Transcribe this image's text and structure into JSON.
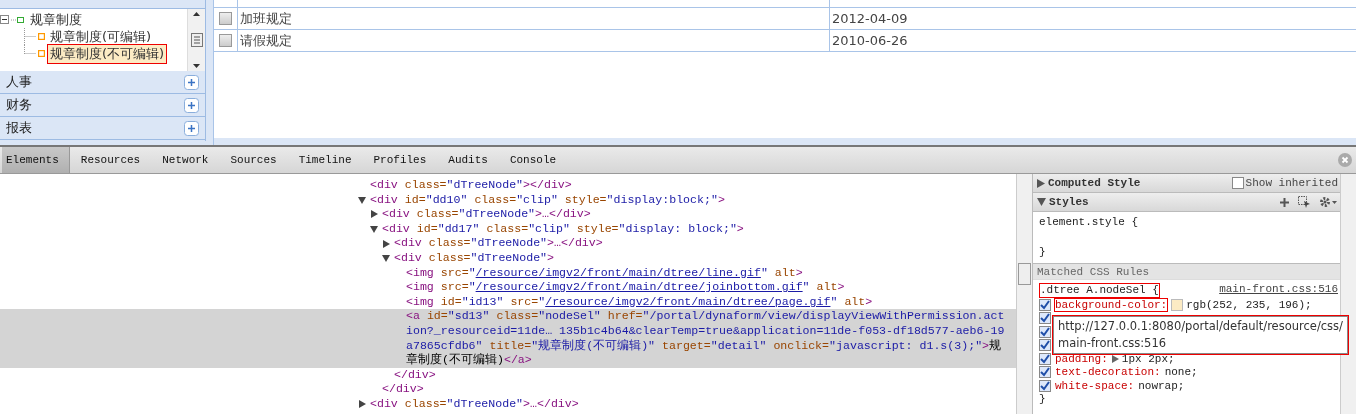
{
  "sidebar": {
    "tree": [
      {
        "label": "规章制度",
        "expanded": true,
        "children": [
          {
            "label": "规章制度(可编辑)",
            "selected": false,
            "annotated": false
          },
          {
            "label": "规章制度(不可编辑)",
            "selected": true,
            "annotated": true
          }
        ]
      }
    ],
    "sections": [
      {
        "label": "人事"
      },
      {
        "label": "财务"
      },
      {
        "label": "报表"
      }
    ]
  },
  "table": {
    "rows": [
      {
        "title": "加班规定",
        "date": "2012-04-09",
        "checked": false
      },
      {
        "title": "请假规定",
        "date": "2010-06-26",
        "checked": false
      }
    ]
  },
  "devtools": {
    "tabs": [
      {
        "label": "Elements",
        "selected": true
      },
      {
        "label": "Resources",
        "selected": false
      },
      {
        "label": "Network",
        "selected": false
      },
      {
        "label": "Sources",
        "selected": false
      },
      {
        "label": "Timeline",
        "selected": false
      },
      {
        "label": "Profiles",
        "selected": false
      },
      {
        "label": "Audits",
        "selected": false
      },
      {
        "label": "Console",
        "selected": false
      }
    ],
    "dom": [
      {
        "selected": false,
        "tokens": [
          {
            "kind": "tag",
            "text": "<div "
          },
          {
            "kind": "attr",
            "text": "class="
          },
          {
            "kind": "value",
            "text": "\"dTreeNode\""
          },
          {
            "kind": "tag",
            "text": "></div>"
          }
        ]
      },
      {
        "expanded": true,
        "selected": false,
        "tokens": [
          {
            "kind": "tag",
            "text": "<div "
          },
          {
            "kind": "attr",
            "text": "id="
          },
          {
            "kind": "value",
            "text": "\"dd10\""
          },
          {
            "kind": "attr",
            "text": " class="
          },
          {
            "kind": "value",
            "text": "\"clip\""
          },
          {
            "kind": "attr",
            "text": " style="
          },
          {
            "kind": "value",
            "text": "\"display:block;\""
          },
          {
            "kind": "tag",
            "text": ">"
          }
        ],
        "children": [
          {
            "expanded": false,
            "selected": false,
            "tokens": [
              {
                "kind": "tag",
                "text": "<div "
              },
              {
                "kind": "attr",
                "text": "class="
              },
              {
                "kind": "value",
                "text": "\"dTreeNode\""
              },
              {
                "kind": "tag",
                "text": ">…</div>"
              }
            ]
          },
          {
            "expanded": true,
            "selected": false,
            "tokens": [
              {
                "kind": "tag",
                "text": "<div "
              },
              {
                "kind": "attr",
                "text": "id="
              },
              {
                "kind": "value",
                "text": "\"dd17\""
              },
              {
                "kind": "attr",
                "text": " class="
              },
              {
                "kind": "value",
                "text": "\"clip\""
              },
              {
                "kind": "attr",
                "text": " style="
              },
              {
                "kind": "value",
                "text": "\"display: block;\""
              },
              {
                "kind": "tag",
                "text": ">"
              }
            ],
            "children": [
              {
                "expanded": false,
                "selected": false,
                "tokens": [
                  {
                    "kind": "tag",
                    "text": "<div "
                  },
                  {
                    "kind": "attr",
                    "text": "class="
                  },
                  {
                    "kind": "value",
                    "text": "\"dTreeNode\""
                  },
                  {
                    "kind": "tag",
                    "text": ">…</div>"
                  }
                ]
              },
              {
                "expanded": true,
                "selected": false,
                "tokens": [
                  {
                    "kind": "tag",
                    "text": "<div "
                  },
                  {
                    "kind": "attr",
                    "text": "class="
                  },
                  {
                    "kind": "value",
                    "text": "\"dTreeNode\""
                  },
                  {
                    "kind": "tag",
                    "text": ">"
                  }
                ],
                "children": [
                  {
                    "selected": false,
                    "tokens": [
                      {
                        "kind": "tag",
                        "text": "<img "
                      },
                      {
                        "kind": "attr",
                        "text": "src="
                      },
                      {
                        "kind": "value",
                        "text": "\""
                      },
                      {
                        "kind": "link",
                        "text": "/resource/imgv2/front/main/dtree/line.gif"
                      },
                      {
                        "kind": "value",
                        "text": "\""
                      },
                      {
                        "kind": "attr",
                        "text": " alt"
                      },
                      {
                        "kind": "tag",
                        "text": ">"
                      }
                    ]
                  },
                  {
                    "selected": false,
                    "tokens": [
                      {
                        "kind": "tag",
                        "text": "<img "
                      },
                      {
                        "kind": "attr",
                        "text": "src="
                      },
                      {
                        "kind": "value",
                        "text": "\""
                      },
                      {
                        "kind": "link",
                        "text": "/resource/imgv2/front/main/dtree/joinbottom.gif"
                      },
                      {
                        "kind": "value",
                        "text": "\""
                      },
                      {
                        "kind": "attr",
                        "text": " alt"
                      },
                      {
                        "kind": "tag",
                        "text": ">"
                      }
                    ]
                  },
                  {
                    "selected": false,
                    "tokens": [
                      {
                        "kind": "tag",
                        "text": "<img "
                      },
                      {
                        "kind": "attr",
                        "text": "id="
                      },
                      {
                        "kind": "value",
                        "text": "\"id13\""
                      },
                      {
                        "kind": "attr",
                        "text": " src="
                      },
                      {
                        "kind": "value",
                        "text": "\""
                      },
                      {
                        "kind": "link",
                        "text": "/resource/imgv2/front/main/dtree/page.gif"
                      },
                      {
                        "kind": "value",
                        "text": "\""
                      },
                      {
                        "kind": "attr",
                        "text": " alt"
                      },
                      {
                        "kind": "tag",
                        "text": ">"
                      }
                    ]
                  },
                  {
                    "selected": true,
                    "tokens": [
                      {
                        "kind": "tag",
                        "text": "<a "
                      },
                      {
                        "kind": "attr",
                        "text": "id="
                      },
                      {
                        "kind": "value",
                        "text": "\"sd13\""
                      },
                      {
                        "kind": "attr",
                        "text": " class="
                      },
                      {
                        "kind": "value",
                        "text": "\"nodeSel\""
                      },
                      {
                        "kind": "attr",
                        "text": " href="
                      },
                      {
                        "kind": "value",
                        "text": "\"/portal/dynaform/view/displayViewWithPermission.action?_resourceid=11de… 135b1c4b64&clearTemp=true&application=11de-f053-df18d577-aeb6-19a7865cfdb6\""
                      },
                      {
                        "kind": "attr",
                        "text": " title="
                      },
                      {
                        "kind": "value",
                        "text": "\"规章制度(不可编辑)\""
                      },
                      {
                        "kind": "attr",
                        "text": " target="
                      },
                      {
                        "kind": "value",
                        "text": "\"detail\""
                      },
                      {
                        "kind": "attr",
                        "text": " onclick="
                      },
                      {
                        "kind": "value",
                        "text": "\"javascript: d1.s(3);\""
                      },
                      {
                        "kind": "tag",
                        "text": ">"
                      },
                      {
                        "kind": "text",
                        "text": "规章制度(不可编辑)"
                      },
                      {
                        "kind": "tag",
                        "text": "</a>"
                      }
                    ]
                  }
                ],
                "close": "</div>"
              }
            ],
            "close": "</div>"
          }
        ]
      },
      {
        "expanded": false,
        "selected": false,
        "tokens": [
          {
            "kind": "tag",
            "text": "<div "
          },
          {
            "kind": "attr",
            "text": "class="
          },
          {
            "kind": "value",
            "text": "\"dTreeNode\""
          },
          {
            "kind": "tag",
            "text": ">…</div>"
          }
        ]
      }
    ],
    "styles": {
      "computed": {
        "title": "Computed Style",
        "expanded": false,
        "show_inherited": {
          "label": "Show inherited",
          "checked": false
        }
      },
      "styles_title": "Styles",
      "styles_expanded": true,
      "element_style": {
        "open": "element.style {",
        "close": "}"
      },
      "matched_title": "Matched CSS Rules",
      "rule": {
        "selector": ".dtree A.nodeSel {",
        "source": "main-front.css:516",
        "annotated": true,
        "close": "}",
        "properties": [
          {
            "kind": "shown",
            "name": "background-color:",
            "value": "rgb(252, 235, 196);",
            "color": "#fcebc4",
            "checked": true,
            "expandable": false,
            "annotated": true
          },
          {
            "kind": "covered",
            "checked": true
          },
          {
            "kind": "covered",
            "checked": true
          },
          {
            "kind": "covered",
            "checked": true
          },
          {
            "kind": "shown",
            "name": "padding:",
            "value": "1px 2px;",
            "checked": true,
            "expandable": true,
            "annotated": false
          },
          {
            "kind": "shown",
            "name": "text-decoration:",
            "value": "none;",
            "checked": true,
            "expandable": false,
            "annotated": false
          },
          {
            "kind": "shown",
            "name": "white-space:",
            "value": "nowrap;",
            "checked": true,
            "expandable": false,
            "annotated": false
          }
        ]
      },
      "tooltip": {
        "lines": [
          "http://127.0.0.1:8080/portal/default/resource/css/",
          "main-front.css:516"
        ]
      }
    }
  }
}
